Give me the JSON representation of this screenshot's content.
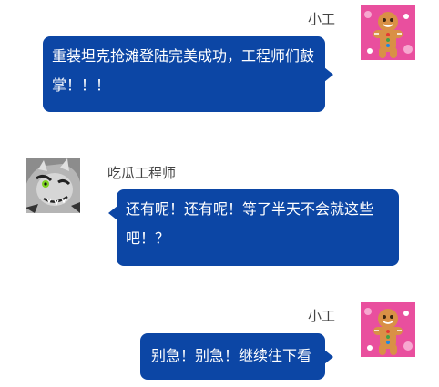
{
  "messages": [
    {
      "sender": "小工",
      "avatar": "gingerbread-man-avatar",
      "side": "right",
      "text": "重装坦克抢滩登陆完美成功，工程师们鼓掌！！！"
    },
    {
      "sender": "吃瓜工程师",
      "avatar": "monster-avatar",
      "side": "left",
      "text": "还有呢！还有呢！等了半天不会就这些吧！？"
    },
    {
      "sender": "小工",
      "avatar": "gingerbread-man-avatar",
      "side": "right",
      "text": "别急！别急！继续往下看"
    }
  ],
  "colors": {
    "bubble": "#0c46a5",
    "bubble_text": "#ffffff",
    "name_text": "#444444",
    "avatar_pink": "#e94f9e",
    "avatar_gray": "#8c8c8c"
  }
}
